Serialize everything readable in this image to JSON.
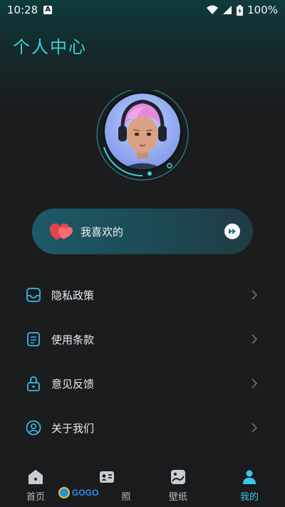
{
  "status_bar": {
    "time": "10:28",
    "notification_badge": "A",
    "battery": "100%"
  },
  "header": {
    "title": "个人中心"
  },
  "favorites": {
    "label": "我喜欢的"
  },
  "menu": [
    {
      "label": "隐私政策",
      "icon": "inbox-icon"
    },
    {
      "label": "使用条款",
      "icon": "document-icon"
    },
    {
      "label": "意见反馈",
      "icon": "lock-icon"
    },
    {
      "label": "关于我们",
      "icon": "user-circle-icon"
    }
  ],
  "tabbar": [
    {
      "label": "首页",
      "icon": "home-icon",
      "active": false
    },
    {
      "label": "照",
      "icon": "id-card-icon",
      "active": false
    },
    {
      "label": "壁纸",
      "icon": "wallpaper-icon",
      "active": false
    },
    {
      "label": "我的",
      "icon": "person-icon",
      "active": true
    }
  ],
  "watermark": {
    "text": "GOGO"
  },
  "colors": {
    "accent": "#39d1d3",
    "active_tab": "#39c9e8",
    "background": "#1b1c1e"
  }
}
